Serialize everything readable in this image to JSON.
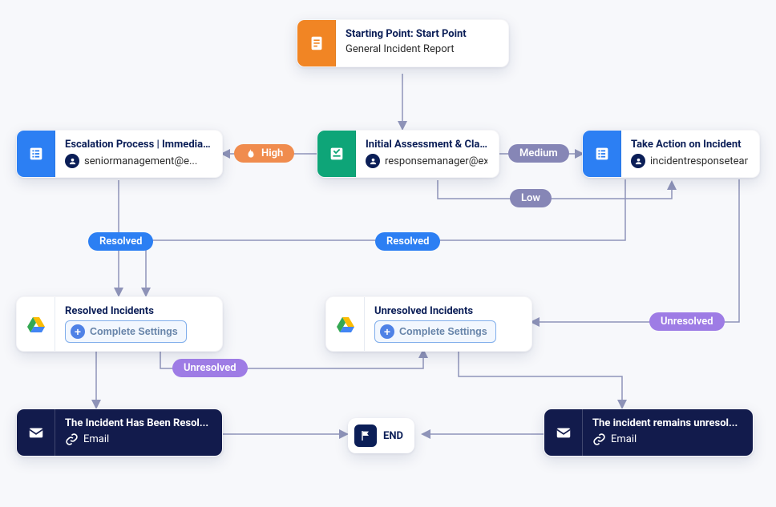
{
  "nodes": {
    "start": {
      "title": "Starting Point: Start Point",
      "subtitle": "General Incident Report"
    },
    "escalation": {
      "title": "Escalation Process | Immedia...",
      "subtitle": "seniormanagement@e..."
    },
    "assessment": {
      "title": "Initial Assessment & Classific...",
      "subtitle": "responsemanager@ex..."
    },
    "takeaction": {
      "title": "Take Action on Incident",
      "subtitle": "incidentresponseteam..."
    },
    "resolved": {
      "title": "Resolved Incidents",
      "button": "Complete Settings"
    },
    "unresolved": {
      "title": "Unresolved Incidents",
      "button": "Complete Settings"
    },
    "incidentResolved": {
      "title": "The Incident Has Been Resol...",
      "subtitle": "Email"
    },
    "incidentUnresolved": {
      "title": "The incident remains unresol...",
      "subtitle": "Email"
    }
  },
  "labels": {
    "high": "High",
    "medium": "Medium",
    "low": "Low",
    "resolved": "Resolved",
    "unresolved": "Unresolved",
    "end": "END"
  },
  "colors": {
    "orange": "#F18524",
    "green": "#0EA578",
    "blue": "#2C7FF3",
    "navy": "#121B4C",
    "badgeGray": "#8686B6",
    "badgeHigh": "#F08C4E",
    "badgePurple": "#9E7CE5",
    "connector": "#8F94B9"
  }
}
